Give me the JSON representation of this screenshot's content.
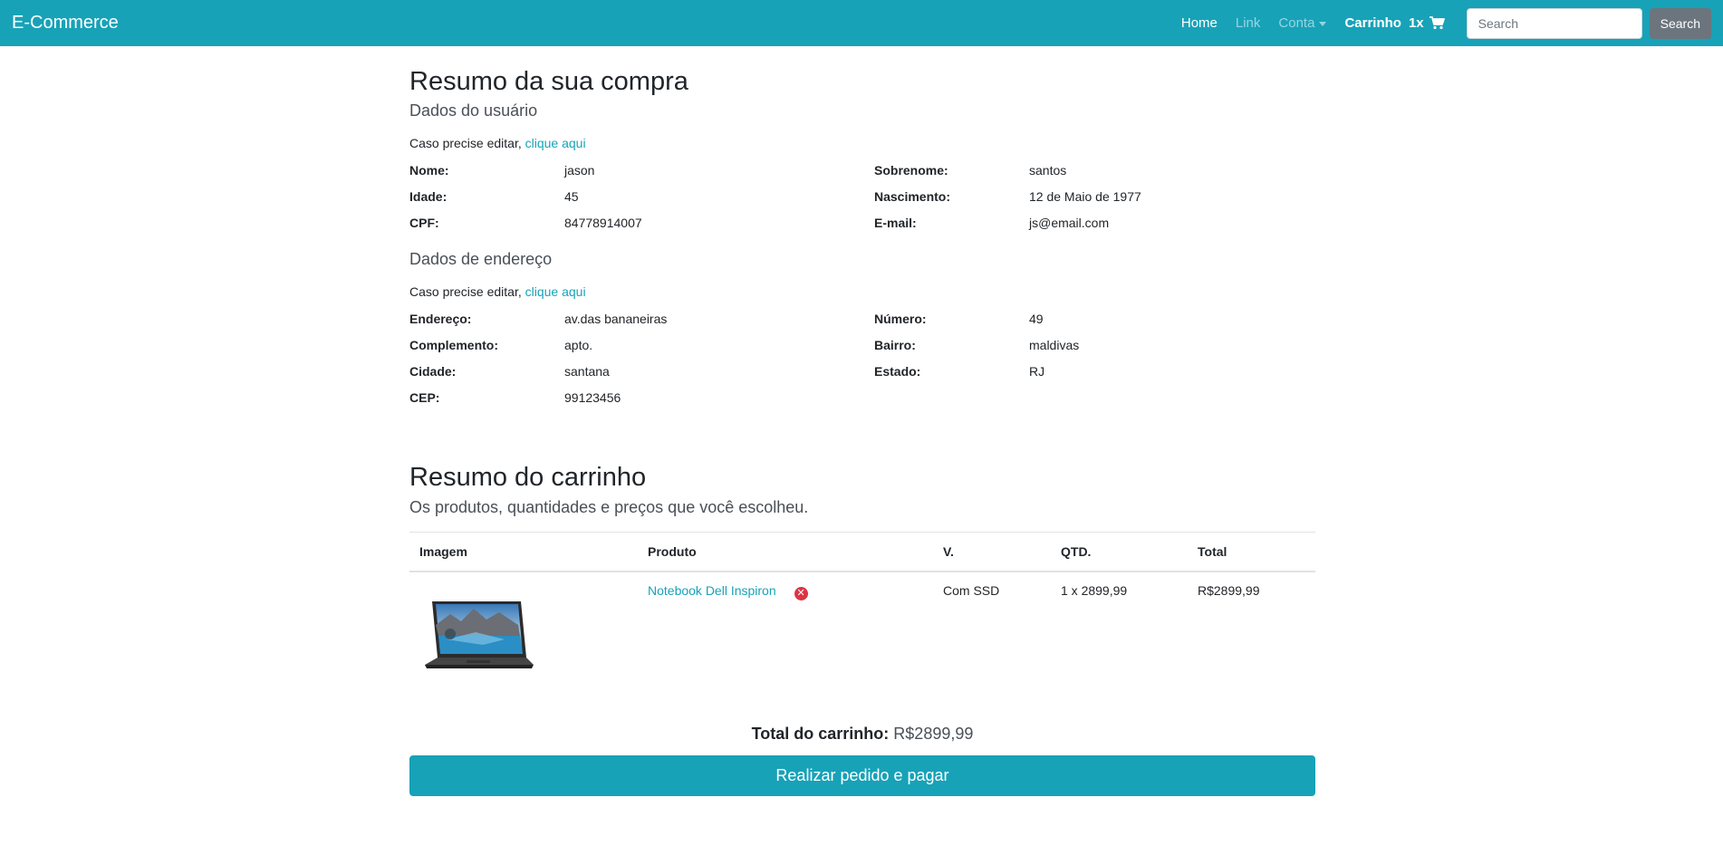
{
  "navbar": {
    "brand": "E-Commerce",
    "links": {
      "home": "Home",
      "link": "Link",
      "account": "Conta",
      "cart": "Carrinho",
      "cart_count": "1x"
    },
    "search": {
      "placeholder": "Search",
      "button": "Search"
    },
    "colors": {
      "bg": "#17a2b8"
    }
  },
  "user_section": {
    "title": "Resumo da sua compra",
    "subtitle": "Dados do usuário",
    "edit_prefix": "Caso precise editar, ",
    "edit_link": "clique aqui",
    "fields": {
      "nome_label": "Nome:",
      "nome_value": "jason",
      "sobrenome_label": "Sobrenome:",
      "sobrenome_value": "santos",
      "idade_label": "Idade:",
      "idade_value": "45",
      "nascimento_label": "Nascimento:",
      "nascimento_value": "12 de Maio de 1977",
      "cpf_label": "CPF:",
      "cpf_value": "84778914007",
      "email_label": "E-mail:",
      "email_value": "js@email.com"
    }
  },
  "address_section": {
    "subtitle": "Dados de endereço",
    "edit_prefix": "Caso precise editar, ",
    "edit_link": "clique aqui",
    "fields": {
      "endereco_label": "Endereço:",
      "endereco_value": "av.das bananeiras",
      "numero_label": "Número:",
      "numero_value": "49",
      "complemento_label": "Complemento:",
      "complemento_value": "apto.",
      "bairro_label": "Bairro:",
      "bairro_value": "maldivas",
      "cidade_label": "Cidade:",
      "cidade_value": "santana",
      "estado_label": "Estado:",
      "estado_value": "RJ",
      "cep_label": "CEP:",
      "cep_value": "99123456"
    }
  },
  "cart_section": {
    "title": "Resumo do carrinho",
    "subtitle": "Os produtos, quantidades e preços que você escolheu.",
    "columns": {
      "image": "Imagem",
      "product": "Produto",
      "variant": "V.",
      "qty": "QTD.",
      "total": "Total"
    },
    "items": [
      {
        "image": "laptop-image",
        "product": "Notebook Dell Inspiron",
        "variant": "Com SSD",
        "qty": "1 x 2899,99",
        "total": "R$2899,99"
      }
    ],
    "total_label": "Total do carrinho:",
    "total_value": "R$2899,99",
    "checkout_button": "Realizar pedido e pagar"
  }
}
